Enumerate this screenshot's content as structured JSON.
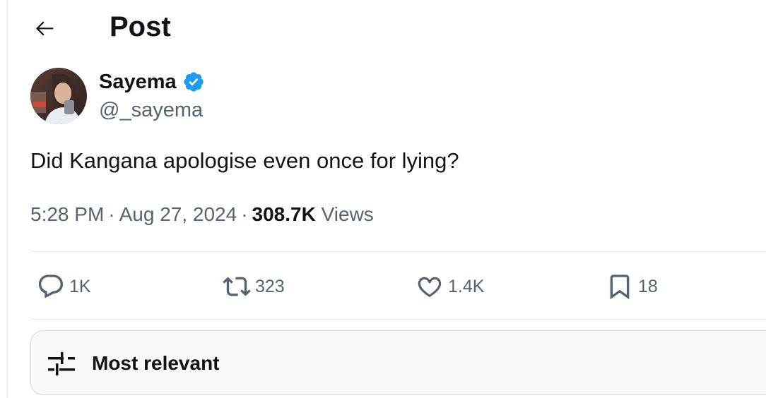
{
  "header": {
    "title": "Post",
    "back_icon": "arrow-left-icon"
  },
  "author": {
    "display_name": "Sayema",
    "handle": "@_sayema",
    "verified": true,
    "verified_color": "#1d9bf0"
  },
  "post": {
    "text": "Did Kangana apologise even once for lying?",
    "time": "5:28 PM",
    "date": "Aug 27, 2024",
    "views_count": "308.7K",
    "views_label": "Views"
  },
  "actions": {
    "replies": {
      "icon": "reply-icon",
      "count": "1K"
    },
    "reposts": {
      "icon": "repost-icon",
      "count": "323"
    },
    "likes": {
      "icon": "heart-icon",
      "count": "1.4K"
    },
    "bookmarks": {
      "icon": "bookmark-icon",
      "count": "18"
    }
  },
  "sort": {
    "icon": "sliders-icon",
    "label": "Most relevant"
  },
  "colors": {
    "text": "#0f1419",
    "secondary": "#536471",
    "border": "#e6e9ec"
  }
}
